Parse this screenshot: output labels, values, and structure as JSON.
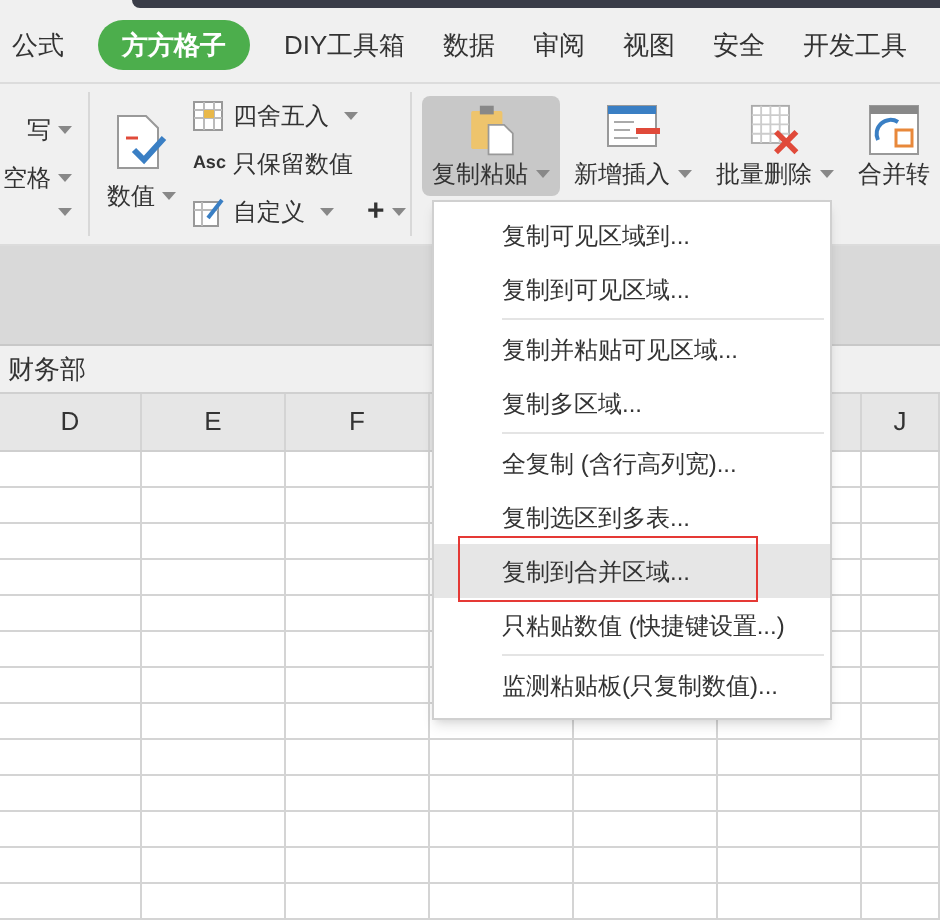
{
  "tabs": [
    {
      "label": "公式",
      "selected": false
    },
    {
      "label": "方方格子",
      "selected": true
    },
    {
      "label": "DIY工具箱",
      "selected": false
    },
    {
      "label": "数据",
      "selected": false
    },
    {
      "label": "审阅",
      "selected": false
    },
    {
      "label": "视图",
      "selected": false
    },
    {
      "label": "安全",
      "selected": false
    },
    {
      "label": "开发工具",
      "selected": false
    }
  ],
  "ribbon": {
    "left_group": [
      "写",
      "空格"
    ],
    "number_group": {
      "main": "数值",
      "items": [
        {
          "label": "四舍五入",
          "dropdown": true,
          "kind": "grid"
        },
        {
          "label": "只保留数值",
          "dropdown": false,
          "kind": "asc",
          "icon_text": "Asc"
        },
        {
          "label": "自定义",
          "dropdown": true,
          "kind": "pen"
        }
      ],
      "extra": "+"
    },
    "tools": [
      {
        "label": "复制粘贴",
        "pressed": true,
        "dropdown": true,
        "kind": "clipboard"
      },
      {
        "label": "新增插入",
        "pressed": false,
        "dropdown": true,
        "kind": "insert"
      },
      {
        "label": "批量删除",
        "pressed": false,
        "dropdown": true,
        "kind": "delete"
      },
      {
        "label": "合并转",
        "pressed": false,
        "dropdown": false,
        "kind": "merge"
      }
    ]
  },
  "formula_bar": {
    "value": "财务部"
  },
  "columns": [
    {
      "label": "D"
    },
    {
      "label": "E"
    },
    {
      "label": "F"
    },
    {},
    {},
    {},
    {
      "label": "J"
    }
  ],
  "menu": [
    {
      "kind": "item",
      "label": "复制可见区域到...",
      "highlighted": false,
      "annotated": false
    },
    {
      "kind": "item",
      "label": "复制到可见区域...",
      "highlighted": false,
      "annotated": false
    },
    {
      "kind": "separator"
    },
    {
      "kind": "item",
      "label": "复制并粘贴可见区域...",
      "highlighted": false,
      "annotated": false
    },
    {
      "kind": "item",
      "label": "复制多区域...",
      "highlighted": false,
      "annotated": false
    },
    {
      "kind": "separator"
    },
    {
      "kind": "item",
      "label": "全复制 (含行高列宽)...",
      "highlighted": false,
      "annotated": false
    },
    {
      "kind": "item",
      "label": "复制选区到多表...",
      "highlighted": false,
      "annotated": false
    },
    {
      "kind": "item",
      "label": "复制到合并区域...",
      "highlighted": true,
      "annotated": true
    },
    {
      "kind": "item",
      "label": "只粘贴数值 (快捷键设置...)",
      "highlighted": false,
      "annotated": false
    },
    {
      "kind": "separator"
    },
    {
      "kind": "item",
      "label": "监测粘贴板(只复制数值)...",
      "highlighted": false,
      "annotated": false
    }
  ]
}
